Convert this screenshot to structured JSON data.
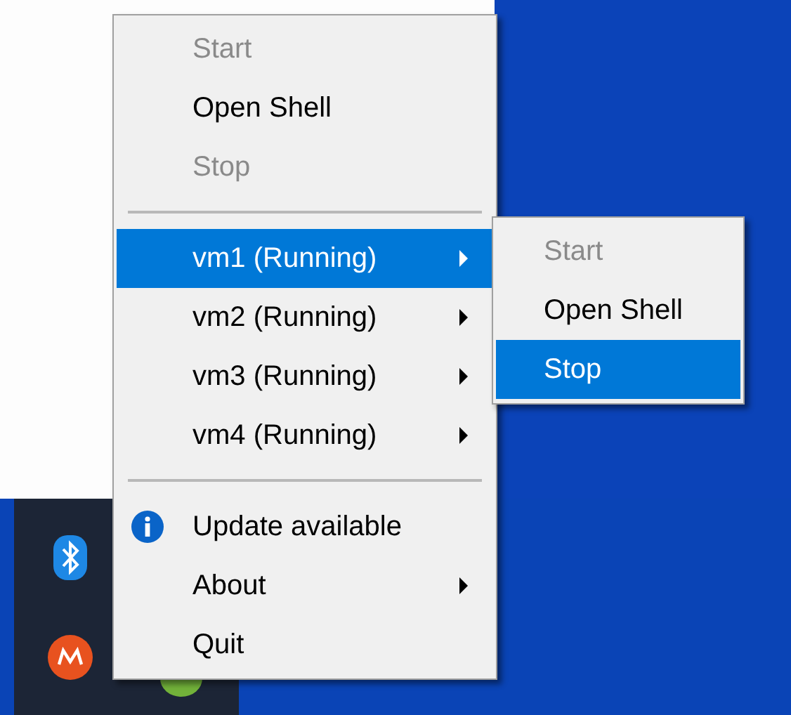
{
  "menu": {
    "items": [
      {
        "kind": "item",
        "label": "Start",
        "disabled": true,
        "selected": false,
        "submenu": false
      },
      {
        "kind": "item",
        "label": "Open Shell",
        "disabled": false,
        "selected": false,
        "submenu": false
      },
      {
        "kind": "item",
        "label": "Stop",
        "disabled": true,
        "selected": false,
        "submenu": false
      },
      {
        "kind": "separator"
      },
      {
        "kind": "item",
        "label": "vm1 (Running)",
        "disabled": false,
        "selected": true,
        "submenu": true
      },
      {
        "kind": "item",
        "label": "vm2 (Running)",
        "disabled": false,
        "selected": false,
        "submenu": true
      },
      {
        "kind": "item",
        "label": "vm3 (Running)",
        "disabled": false,
        "selected": false,
        "submenu": true
      },
      {
        "kind": "item",
        "label": "vm4 (Running)",
        "disabled": false,
        "selected": false,
        "submenu": true
      },
      {
        "kind": "separator"
      },
      {
        "kind": "info",
        "label": "Update available",
        "disabled": false,
        "selected": false,
        "submenu": false
      },
      {
        "kind": "item",
        "label": "About",
        "disabled": false,
        "selected": false,
        "submenu": true
      },
      {
        "kind": "item",
        "label": "Quit",
        "disabled": false,
        "selected": false,
        "submenu": false
      }
    ]
  },
  "submenu": {
    "items": [
      {
        "label": "Start",
        "disabled": true,
        "selected": false
      },
      {
        "label": "Open Shell",
        "disabled": false,
        "selected": false
      },
      {
        "label": "Stop",
        "disabled": false,
        "selected": true
      }
    ]
  }
}
